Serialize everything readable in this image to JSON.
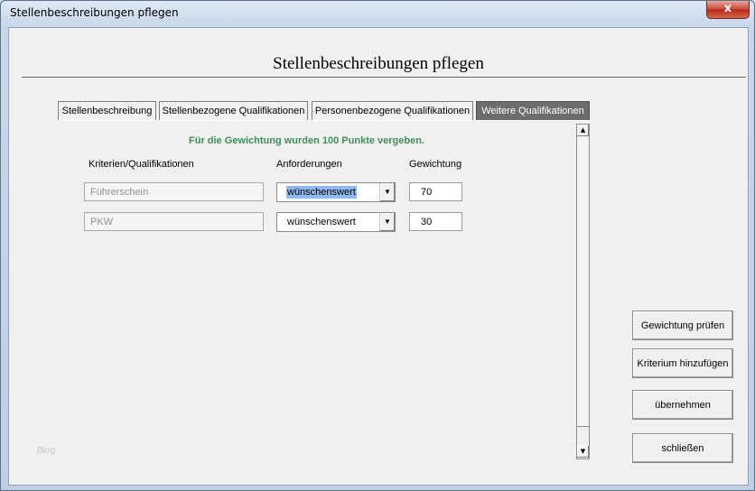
{
  "window": {
    "title": "Stellenbeschreibungen pflegen",
    "close_glyph": "x"
  },
  "header": {
    "title": "Stellenbeschreibungen pflegen"
  },
  "tabs": [
    {
      "label": "Stellenbeschreibung",
      "active": false
    },
    {
      "label": "Stellenbezogene Qualifikationen",
      "active": false
    },
    {
      "label": "Personenbezogene Qualifikationen",
      "active": false
    },
    {
      "label": "Weitere Qualifikationen",
      "active": true
    }
  ],
  "info_message": "Für die Gewichtung wurden 100 Punkte vergeben.",
  "columns": {
    "criteria": "Kriterien/Qualifikationen",
    "requirement": "Anforderungen",
    "weight": "Gewichtung"
  },
  "rows": [
    {
      "criterion": "Führerschein",
      "requirement": "wünschenswert",
      "weight": "70"
    },
    {
      "criterion": "PKW",
      "requirement": "wünschenswert",
      "weight": "30"
    }
  ],
  "buttons": {
    "check_weight": "Gewichtung prüfen",
    "add_criterion": "Kriterium hinzufügen",
    "apply": "übernehmen",
    "close": "schließen"
  },
  "footer": {
    "watermark": "Blog"
  },
  "colors": {
    "info_green": "#3f8f5a",
    "active_tab": "#6d6d6d",
    "close_red": "#c7473a"
  }
}
